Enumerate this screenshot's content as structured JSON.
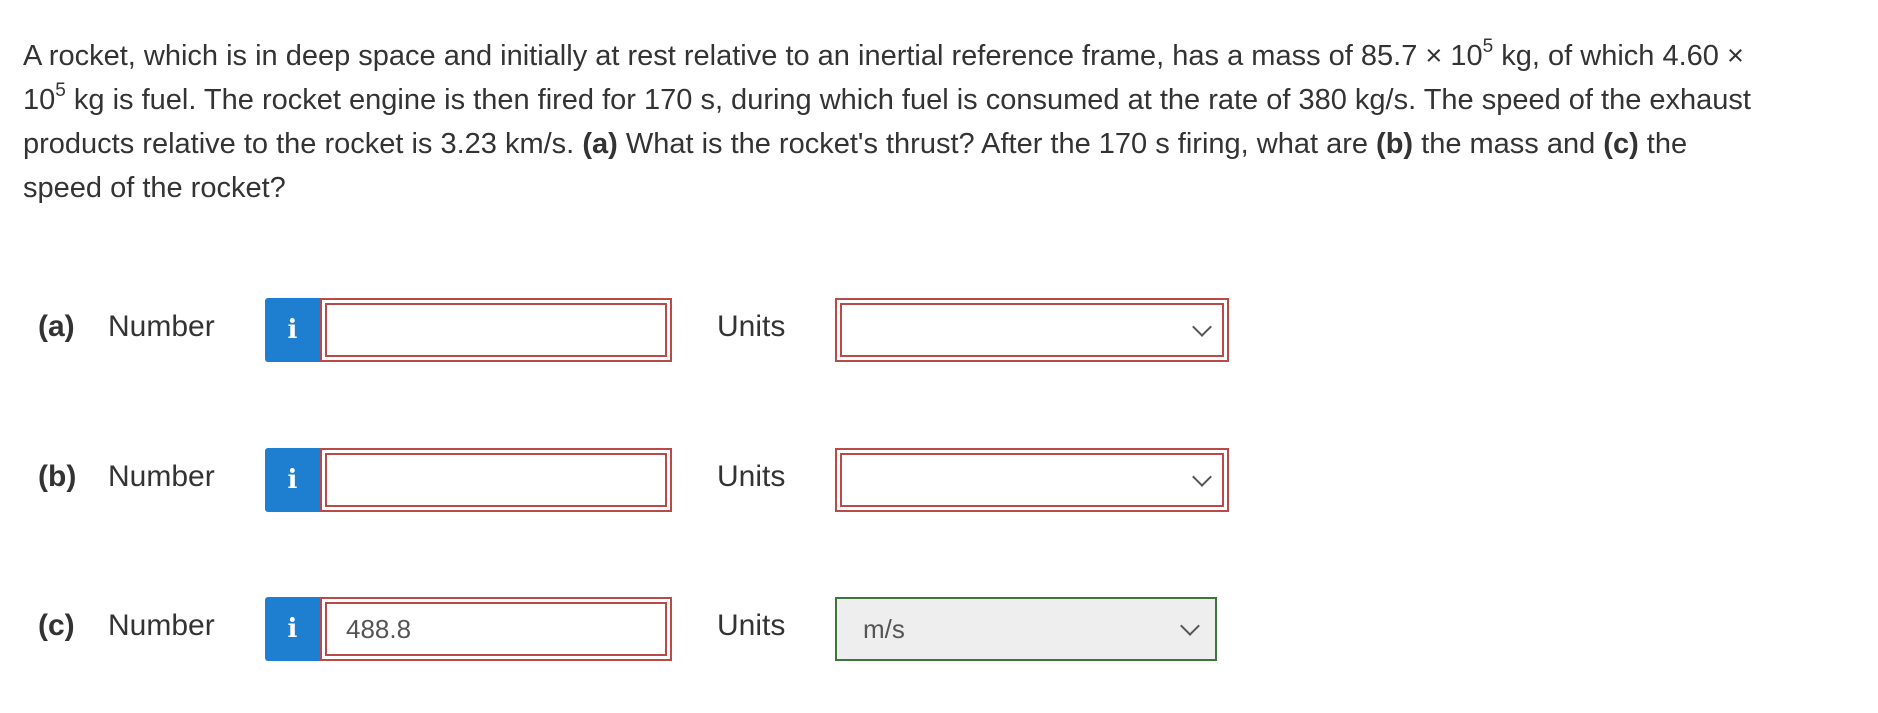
{
  "question": {
    "line1_a": "A rocket, which is in deep space and initially at rest relative to an inertial reference frame, has a mass of 85.7 × 10",
    "line1_exp": "5",
    "line1_b": " kg, of which 4.60 ×",
    "line2_exp": "5",
    "line2_b": " kg is fuel. The rocket engine is then fired for 170 s, during which fuel is consumed at the rate of 380 kg/s. The speed of the exhaust",
    "line2_base": "10",
    "line3_a": "products relative to the rocket is 3.23 km/s. ",
    "part_a_tag": "(a)",
    "line3_b": " What is the rocket's thrust? After the 170 s firing, what are ",
    "part_b_tag": "(b)",
    "line3_c": " the mass and ",
    "part_c_tag": "(c)",
    "line3_d": " the",
    "line4": "speed of the rocket?"
  },
  "parts": [
    {
      "label": "(a)",
      "number_label": "Number",
      "info_icon": "i",
      "value": "",
      "units_label": "Units",
      "units_value": ""
    },
    {
      "label": "(b)",
      "number_label": "Number",
      "info_icon": "i",
      "value": "",
      "units_label": "Units",
      "units_value": ""
    },
    {
      "label": "(c)",
      "number_label": "Number",
      "info_icon": "i",
      "value": "488.8",
      "units_label": "Units",
      "units_value": "m/s"
    }
  ],
  "colors": {
    "info_button": "#1e7fd0",
    "error_border": "#b94a48",
    "answered_border": "#3c763d"
  }
}
